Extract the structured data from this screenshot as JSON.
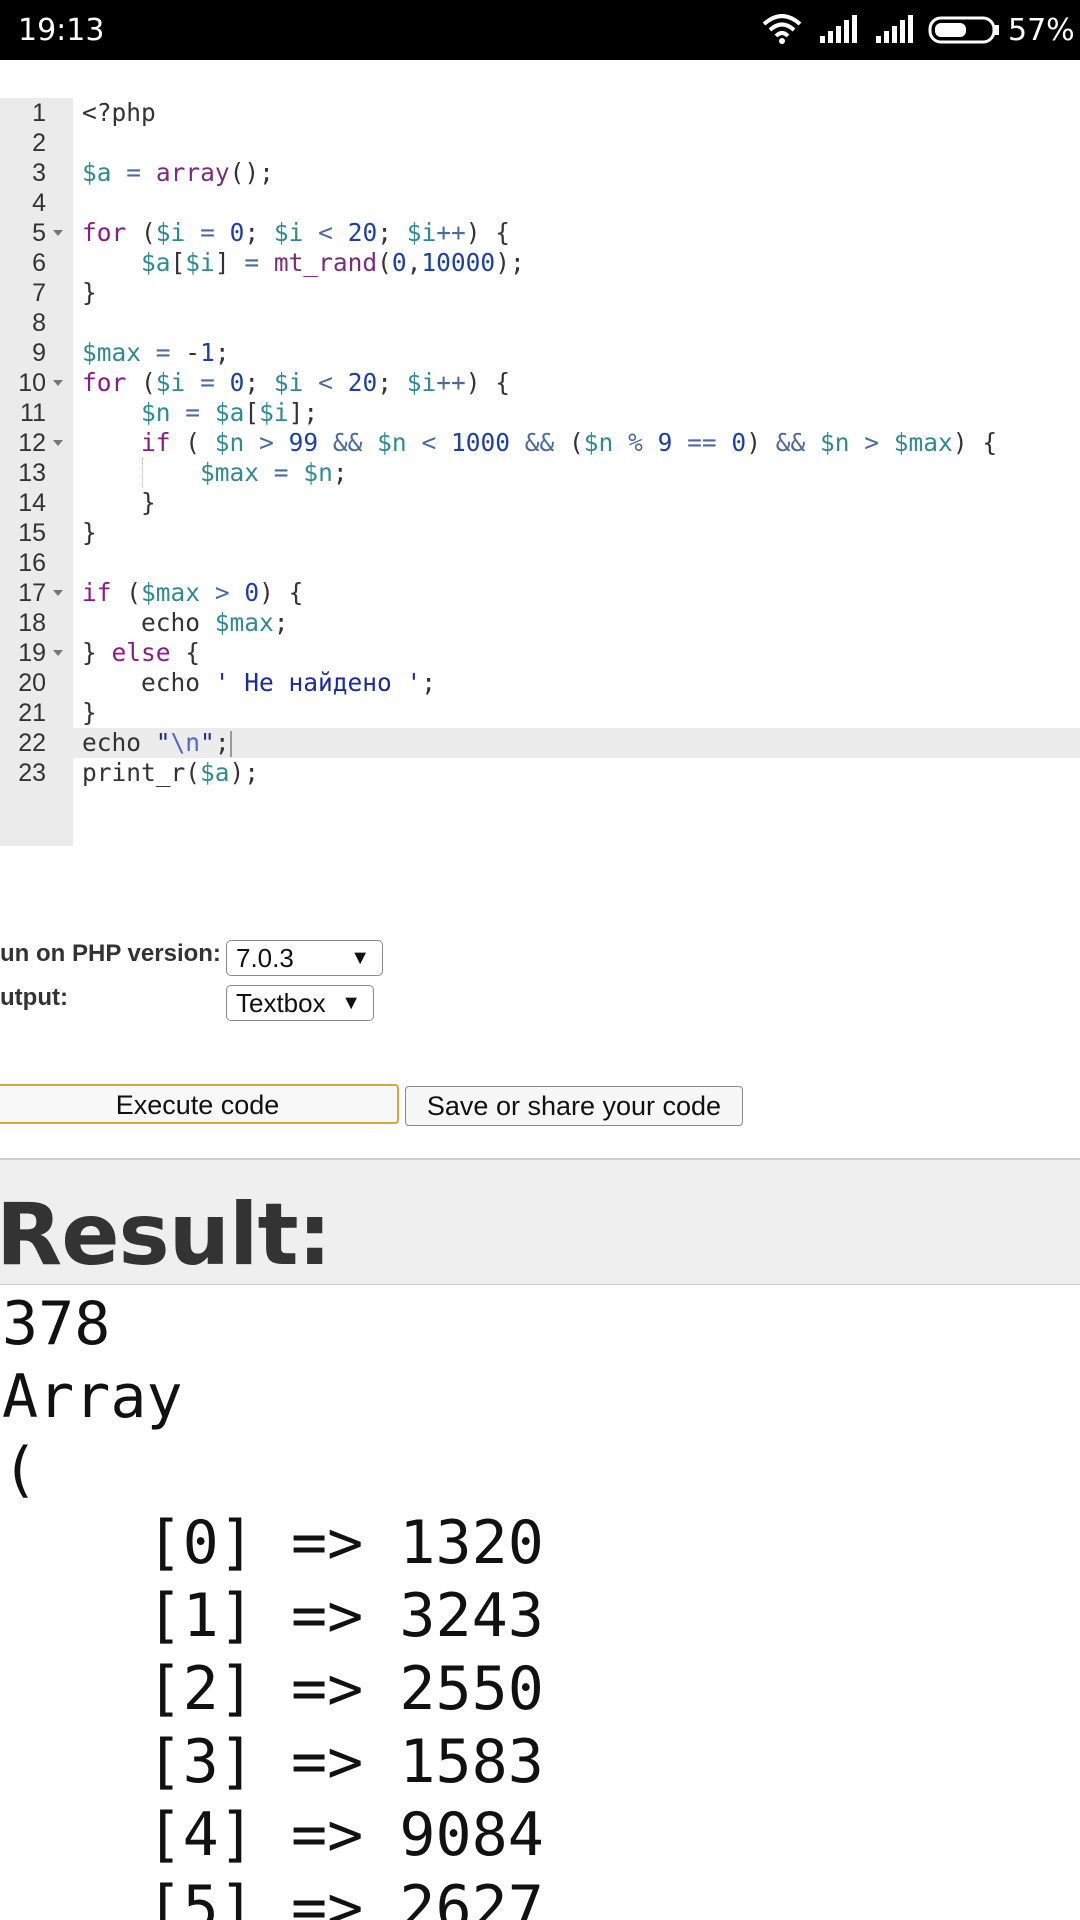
{
  "status_bar": {
    "time": "19:13",
    "battery_percent": "57%",
    "battery_level": 0.57,
    "icons": [
      "wifi-icon",
      "signal-icon",
      "signal-icon",
      "battery-icon"
    ]
  },
  "editor": {
    "active_line": "22",
    "lines": [
      {
        "n": "1",
        "text": "<?php"
      },
      {
        "n": "2",
        "text": ""
      },
      {
        "n": "3",
        "text": "$a = array();"
      },
      {
        "n": "4",
        "text": ""
      },
      {
        "n": "5",
        "text": "for ($i = 0; $i < 20; $i++) {"
      },
      {
        "n": "6",
        "text": "    $a[$i] = mt_rand(0,10000);"
      },
      {
        "n": "7",
        "text": "}"
      },
      {
        "n": "8",
        "text": ""
      },
      {
        "n": "9",
        "text": "$max = -1;"
      },
      {
        "n": "10",
        "text": "for ($i = 0; $i < 20; $i++) {"
      },
      {
        "n": "11",
        "text": "    $n = $a[$i];"
      },
      {
        "n": "12",
        "text": "    if ( $n > 99 && $n < 1000 && ($n % 9 == 0) && $n > $max) {"
      },
      {
        "n": "13",
        "text": "        $max = $n;"
      },
      {
        "n": "14",
        "text": "    }"
      },
      {
        "n": "15",
        "text": "}"
      },
      {
        "n": "16",
        "text": ""
      },
      {
        "n": "17",
        "text": "if ($max > 0) {"
      },
      {
        "n": "18",
        "text": "    echo $max;"
      },
      {
        "n": "19",
        "text": "} else {"
      },
      {
        "n": "20",
        "text": "    echo ' Не найдено ';"
      },
      {
        "n": "21",
        "text": "}"
      },
      {
        "n": "22",
        "text": "echo \"\\n\";"
      },
      {
        "n": "23",
        "text": "print_r($a);"
      }
    ]
  },
  "form": {
    "php_version_label": "un on PHP version:",
    "php_version_value": "7.0.3",
    "output_label": "utput:",
    "output_value": "Textbox",
    "dropdown_arrow": "▼"
  },
  "buttons": {
    "execute": "Execute code",
    "save_share": "Save or share your code"
  },
  "result": {
    "title": "Result:",
    "output_lines": [
      "378",
      "Array",
      "(",
      "    [0] => 1320",
      "    [1] => 3243",
      "    [2] => 2550",
      "    [3] => 1583",
      "    [4] => 9084",
      "    [5] => 2627"
    ]
  },
  "colors": {
    "status_bar_bg": "#000000",
    "gutter_bg": "#ebebeb",
    "execute_border": "#d4a83a",
    "result_header_bg": "#efefef"
  }
}
